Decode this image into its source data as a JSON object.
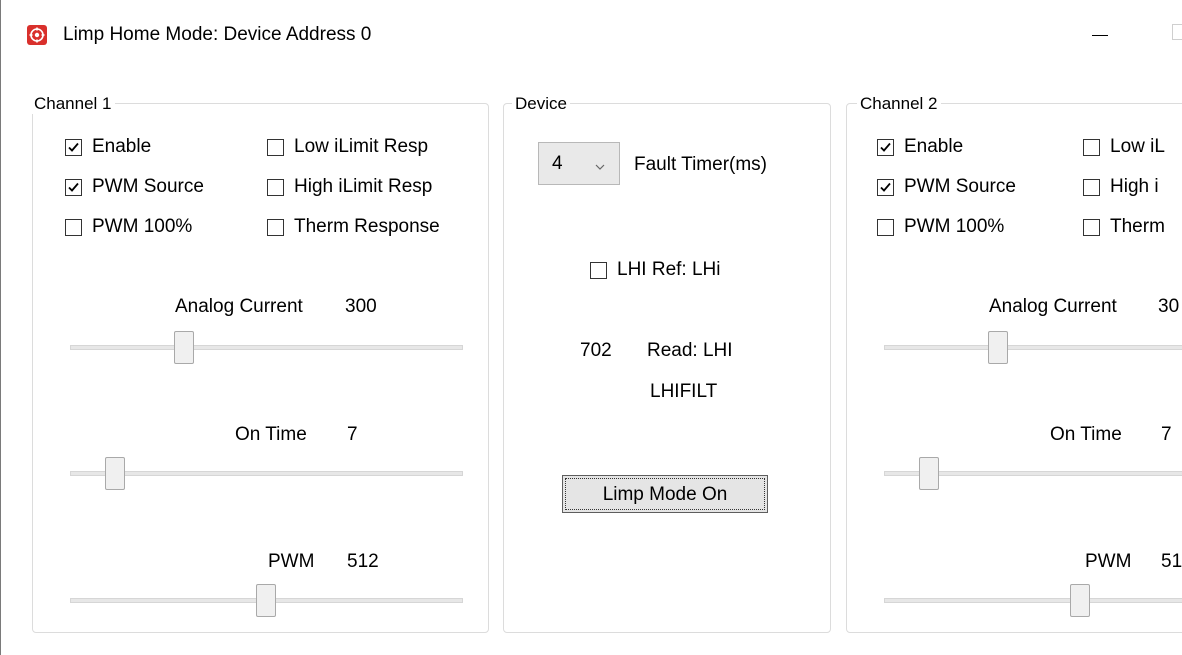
{
  "window": {
    "title": "Limp Home Mode: Device Address 0",
    "icon": "app-icon",
    "controls": [
      "minimize-icon",
      "maximize-icon"
    ]
  },
  "channel1": {
    "label": "Channel 1",
    "checkboxes": [
      {
        "label": "Enable",
        "checked": true
      },
      {
        "label": "PWM Source",
        "checked": true
      },
      {
        "label": "PWM 100%",
        "checked": false
      },
      {
        "label": "Low iLimit Resp",
        "checked": false
      },
      {
        "label": "High iLimit Resp",
        "checked": false
      },
      {
        "label": "Therm Response",
        "checked": false
      }
    ],
    "analog_current": {
      "label": "Analog Current",
      "value": "300"
    },
    "on_time": {
      "label": "On Time",
      "value": "7"
    },
    "pwm": {
      "label": "PWM",
      "value": "512"
    }
  },
  "device": {
    "label": "Device",
    "fault_timer": {
      "value": "4",
      "label": "Fault Timer(ms)"
    },
    "lhi_ref": {
      "label": "LHI Ref: LHi",
      "checked": false
    },
    "read_value": "702",
    "read_label": "Read: LHI",
    "read_sublabel": "LHIFILT",
    "limp_button": "Limp Mode On"
  },
  "channel2": {
    "label": "Channel 2",
    "checkboxes": [
      {
        "label": "Enable",
        "checked": true
      },
      {
        "label": "PWM Source",
        "checked": true
      },
      {
        "label": "PWM 100%",
        "checked": false
      },
      {
        "label": "Low iL",
        "checked": false
      },
      {
        "label": "High i",
        "checked": false
      },
      {
        "label": "Therm",
        "checked": false
      }
    ],
    "analog_current": {
      "label": "Analog Current",
      "value": "30"
    },
    "on_time": {
      "label": "On Time",
      "value": "7"
    },
    "pwm": {
      "label": "PWM",
      "value": "51"
    }
  }
}
